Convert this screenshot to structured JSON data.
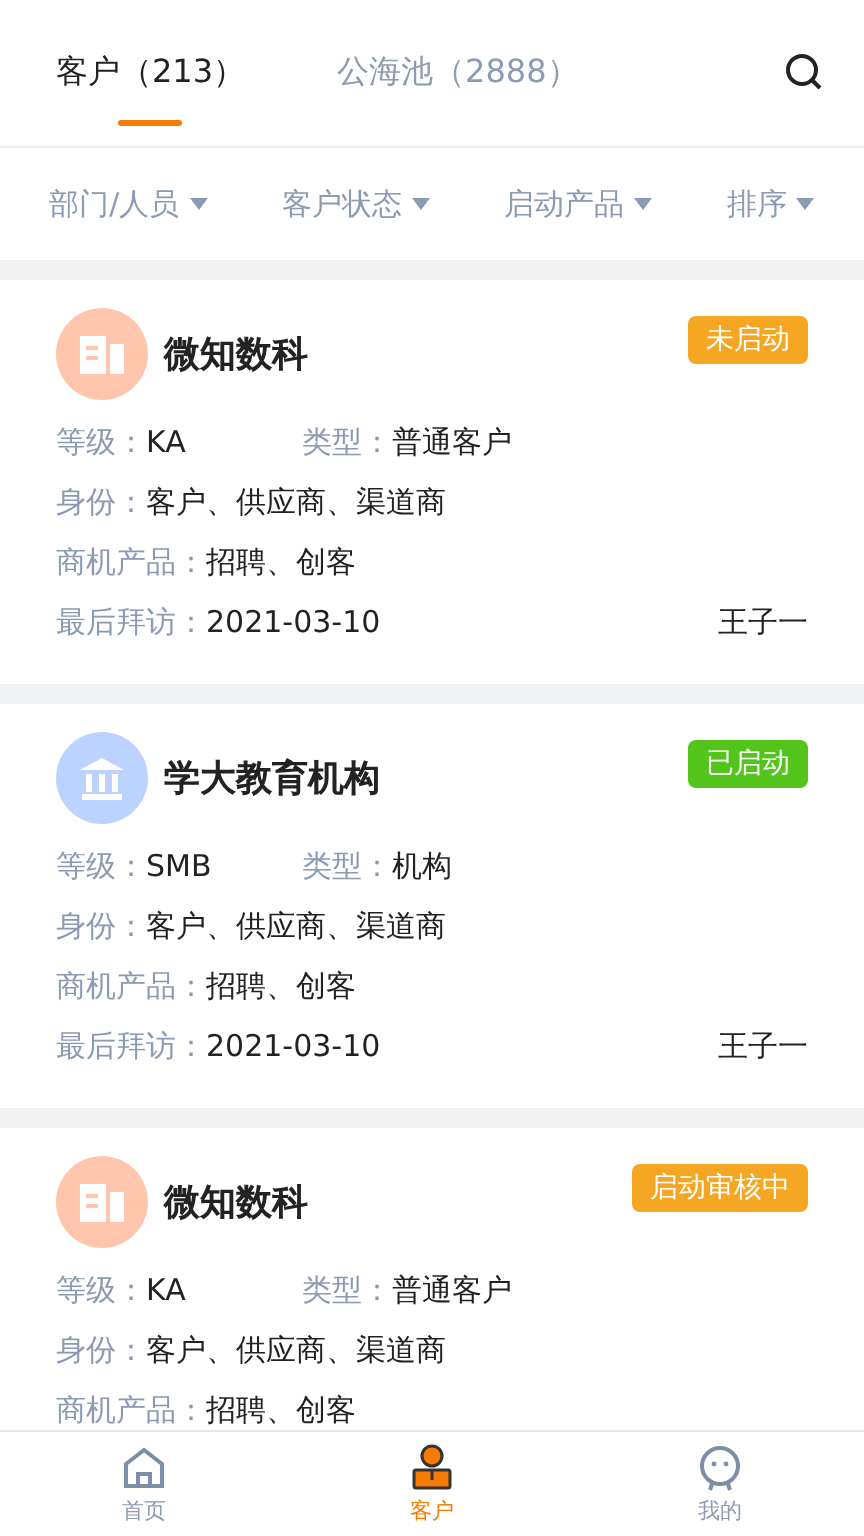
{
  "tabs": [
    {
      "label": "客户（213）",
      "selected": true
    },
    {
      "label": "公海池（2888）",
      "selected": false
    }
  ],
  "filters": [
    "部门/人员",
    "客户状态",
    "启动产品",
    "排序"
  ],
  "customers": [
    {
      "name": "微知数科",
      "avatar": {
        "kind": "company"
      },
      "status": {
        "label": "未启动",
        "color": "#f5a623"
      },
      "level_label": "等级：",
      "level": "KA",
      "type_label": "类型：",
      "type": "普通客户",
      "role_label": "身份：",
      "role": "客户、供应商、渠道商",
      "product_label": "商机产品：",
      "product": "招聘、创客",
      "visit_label": "最后拜访：",
      "visit": "2021-03-10",
      "owner": "王子一"
    },
    {
      "name": "学大教育机构",
      "avatar": {
        "kind": "institution"
      },
      "status": {
        "label": "已启动",
        "color": "#52c41a"
      },
      "level_label": "等级：",
      "level": "SMB",
      "type_label": "类型：",
      "type": "机构",
      "role_label": "身份：",
      "role": "客户、供应商、渠道商",
      "product_label": "商机产品：",
      "product": "招聘、创客",
      "visit_label": "最后拜访：",
      "visit": "2021-03-10",
      "owner": "王子一"
    },
    {
      "name": "微知数科",
      "avatar": {
        "kind": "company"
      },
      "status": {
        "label": "启动审核中",
        "color": "#f5a623"
      },
      "level_label": "等级：",
      "level": "KA",
      "type_label": "类型：",
      "type": "普通客户",
      "role_label": "身份：",
      "role": "客户、供应商、渠道商",
      "product_label": "商机产品：",
      "product": "招聘、创客"
    }
  ],
  "nav": [
    {
      "label": "首页",
      "kind": "home",
      "selected": false
    },
    {
      "label": "客户",
      "kind": "customer",
      "selected": true
    },
    {
      "label": "我的",
      "kind": "profile",
      "selected": false
    }
  ]
}
